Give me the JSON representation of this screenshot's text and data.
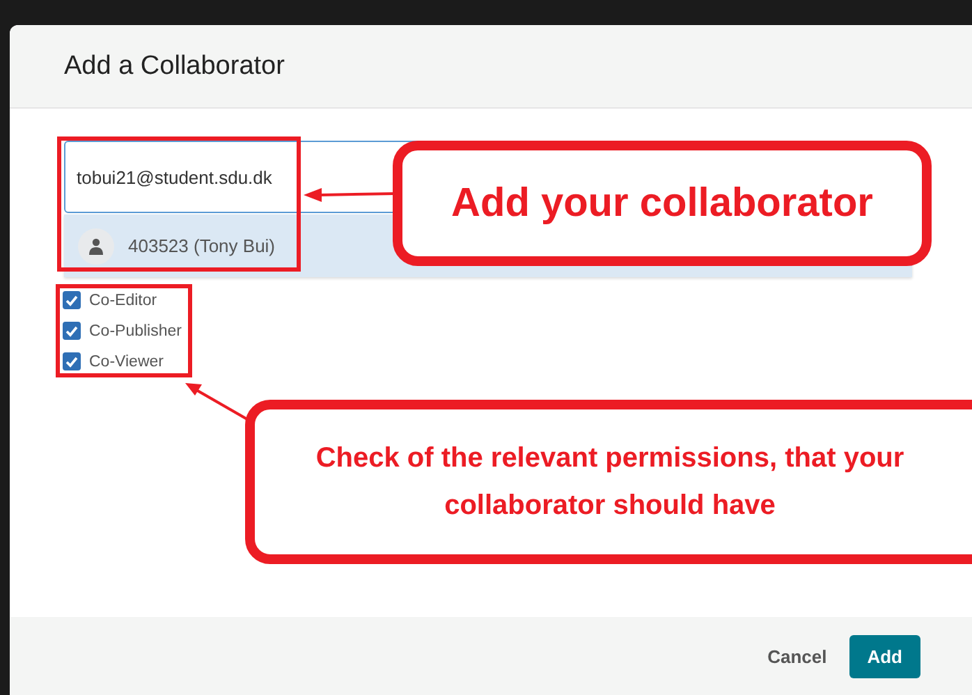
{
  "dialog": {
    "title": "Add a Collaborator"
  },
  "search": {
    "value": "tobui21@student.sdu.dk"
  },
  "suggestions": [
    {
      "label": "403523 (Tony Bui)",
      "selected": true
    }
  ],
  "permissions": [
    {
      "label": "Co-Editor",
      "checked": true
    },
    {
      "label": "Co-Publisher",
      "checked": true
    },
    {
      "label": "Co-Viewer",
      "checked": true
    }
  ],
  "buttons": [
    {
      "label": "Cancel",
      "kind": "link"
    },
    {
      "label": "Add",
      "kind": "primary"
    }
  ],
  "annotations": [
    {
      "text": "Add your collaborator"
    },
    {
      "text": "Check of the relevant permissions, that your collaborator should have"
    }
  ]
}
